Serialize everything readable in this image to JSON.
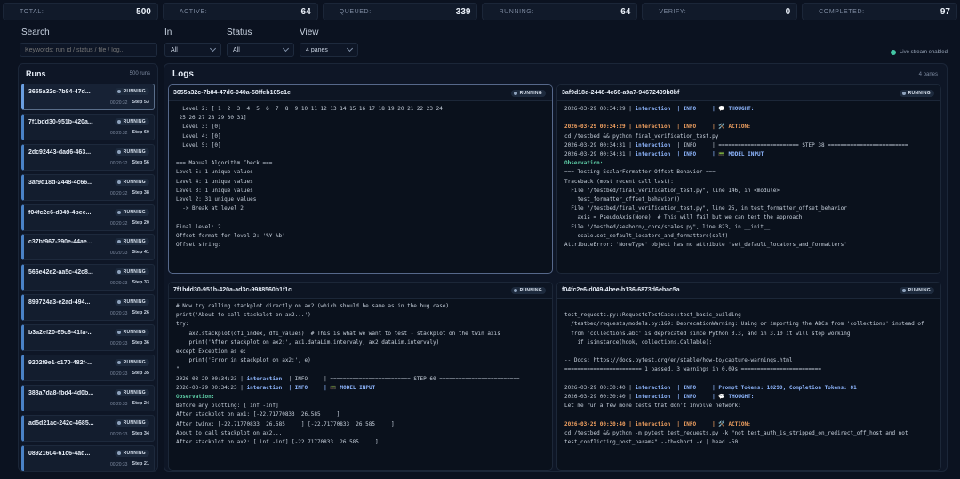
{
  "stats": [
    {
      "label": "TOTAL:",
      "value": "500"
    },
    {
      "label": "ACTIVE:",
      "value": "64"
    },
    {
      "label": "QUEUED:",
      "value": "339"
    },
    {
      "label": "RUNNING:",
      "value": "64"
    },
    {
      "label": "VERIFY:",
      "value": "0"
    },
    {
      "label": "COMPLETED:",
      "value": "97"
    }
  ],
  "filters": {
    "search_label": "Search",
    "search_placeholder": "Keywords: run id / status / file / log...",
    "in_label": "In",
    "in_value": "All",
    "status_label": "Status",
    "status_value": "All",
    "view_label": "View",
    "view_value": "4 panes",
    "live_label": "Live stream enabled"
  },
  "runs": {
    "title": "Runs",
    "count": "500 runs",
    "items": [
      {
        "id": "3655a32c-7b84-47d...",
        "status": "RUNNING",
        "time": "00:20:32",
        "step": "Step 53"
      },
      {
        "id": "7f1bdd30-951b-420a...",
        "status": "RUNNING",
        "time": "00:20:32",
        "step": "Step 60"
      },
      {
        "id": "2dc92443-dad6-463...",
        "status": "RUNNING",
        "time": "00:20:32",
        "step": "Step 56"
      },
      {
        "id": "3af9d18d-2448-4c66...",
        "status": "RUNNING",
        "time": "00:20:32",
        "step": "Step 38"
      },
      {
        "id": "f04fc2e6-d049-4bee...",
        "status": "RUNNING",
        "time": "00:20:32",
        "step": "Step 20"
      },
      {
        "id": "c37bf967-390e-44ae...",
        "status": "RUNNING",
        "time": "00:20:33",
        "step": "Step 41"
      },
      {
        "id": "566e42e2-aa5c-42c8...",
        "status": "RUNNING",
        "time": "00:20:33",
        "step": "Step 33"
      },
      {
        "id": "899724a3-e2ad-494...",
        "status": "RUNNING",
        "time": "00:20:33",
        "step": "Step 26"
      },
      {
        "id": "b3a2ef20-65c6-41fa-...",
        "status": "RUNNING",
        "time": "00:20:33",
        "step": "Step 36"
      },
      {
        "id": "9202f9e1-c170-482f-...",
        "status": "RUNNING",
        "time": "00:20:33",
        "step": "Step 35"
      },
      {
        "id": "388a7da8-fbd4-4d0b...",
        "status": "RUNNING",
        "time": "00:20:33",
        "step": "Step 24"
      },
      {
        "id": "ad5d21ac-242c-4685...",
        "status": "RUNNING",
        "time": "00:20:33",
        "step": "Step 34"
      },
      {
        "id": "08921604-61c6-4ad...",
        "status": "RUNNING",
        "time": "00:20:33",
        "step": "Step 21"
      }
    ]
  },
  "logs": {
    "title": "Logs",
    "count": "4 panes",
    "panes": [
      {
        "title": "3655a32c-7b84-47d6-940a-58ffeb105c1e",
        "status": "RUNNING",
        "lines": [
          "  Level 2: [ 1  2  3  4  5  6  7  8  9 10 11 12 13 14 15 16 17 18 19 20 21 22 23 24",
          " 25 26 27 28 29 30 31]",
          "  Level 3: [0]",
          "  Level 4: [0]",
          "  Level 5: [0]",
          "",
          "=== Manual Algorithm Check ===",
          "Level 5: 1 unique values",
          "Level 4: 1 unique values",
          "Level 3: 1 unique values",
          "Level 2: 31 unique values",
          "  -> Break at level 2",
          "",
          "Final level: 2",
          "Offset format for level 2: '%Y-%b'",
          "Offset string:"
        ]
      },
      {
        "title": "3af9d18d-2448-4c66-a9a7-94672409b8bf",
        "status": "RUNNING",
        "lines": [
          "2026-03-29 00:34:29 | interaction  | INFO     | 💬 THOUGHT:",
          "",
          "2026-03-29 00:34:29 | interaction  | INFO     | 🛠️ ACTION:",
          "cd /testbed && python final_verification_test.py",
          "2026-03-29 00:34:31 | interaction  | INFO     | ========================= STEP 38 =========================",
          "2026-03-29 00:34:31 | interaction  | INFO     | 📟 MODEL INPUT",
          "Observation:",
          "=== Testing ScalarFormatter Offset Behavior ===",
          "Traceback (most recent call last):",
          "  File \"/testbed/final_verification_test.py\", line 146, in <module>",
          "    test_formatter_offset_behavior()",
          "  File \"/testbed/final_verification_test.py\", line 25, in test_formatter_offset_behavior",
          "    axis = PseudoAxis(None)  # This will fail but we can test the approach",
          "  File \"/testbed/seaborn/_core/scales.py\", line 823, in __init__",
          "    scale.set_default_locators_and_formatters(self)",
          "AttributeError: 'NoneType' object has no attribute 'set_default_locators_and_formatters'"
        ]
      },
      {
        "title": "7f1bdd30-951b-420a-ad3c-9988560b1f1c",
        "status": "RUNNING",
        "lines": [
          "# Now try calling stackplot directly on ax2 (which should be same as in the bug case)",
          "print('About to call stackplot on ax2...')",
          "try:",
          "    ax2.stackplot(df1_index, df1_values)  # This is what we want to test - stackplot on the twin axis",
          "    print('After stackplot on ax2:', ax1.dataLim.intervaly, ax2.dataLim.intervaly)",
          "except Exception as e:",
          "    print('Error in stackplot on ax2:', e)",
          "\"",
          "2026-03-29 00:34:23 | interaction  | INFO     | ========================= STEP 60 =========================",
          "2026-03-29 00:34:23 | interaction  | INFO     | 📟 MODEL INPUT",
          "Observation:",
          "Before any plotting: [ inf -inf]",
          "After stackplot on ax1: [-22.71770833  26.585     ]",
          "After twinx: [-22.71770833  26.585     ] [-22.71770833  26.585     ]",
          "About to call stackplot on ax2...",
          "After stackplot on ax2: [ inf -inf] [-22.71770833  26.585     ]"
        ]
      },
      {
        "title": "f04fc2e6-d049-4bee-b136-6873d6ebac5a",
        "status": "RUNNING",
        "lines": [
          "",
          "test_requests.py::RequestsTestCase::test_basic_building",
          "  /testbed/requests/models.py:169: DeprecationWarning: Using or importing the ABCs from 'collections' instead of",
          "  from 'collections.abc' is deprecated since Python 3.3, and in 3.10 it will stop working",
          "    if isinstance(hook, collections.Callable):",
          "",
          "-- Docs: https://docs.pytest.org/en/stable/how-to/capture-warnings.html",
          "======================== 1 passed, 3 warnings in 0.09s =========================",
          "",
          "2026-03-29 00:30:40 | interaction  | INFO     | Prompt Tokens: 18299, Completion Tokens: 81",
          "2026-03-29 00:30:40 | interaction  | INFO     | 💬 THOUGHT:",
          "Let me run a few more tests that don't involve network:",
          "",
          "2026-03-29 00:30:40 | interaction  | INFO     | 🛠️ ACTION:",
          "cd /testbed && python -m pytest test_requests.py -k \"not test_auth_is_stripped_on_redirect_off_host and not",
          "test_conflicting_post_params\" --tb=short -x | head -50"
        ]
      }
    ]
  }
}
